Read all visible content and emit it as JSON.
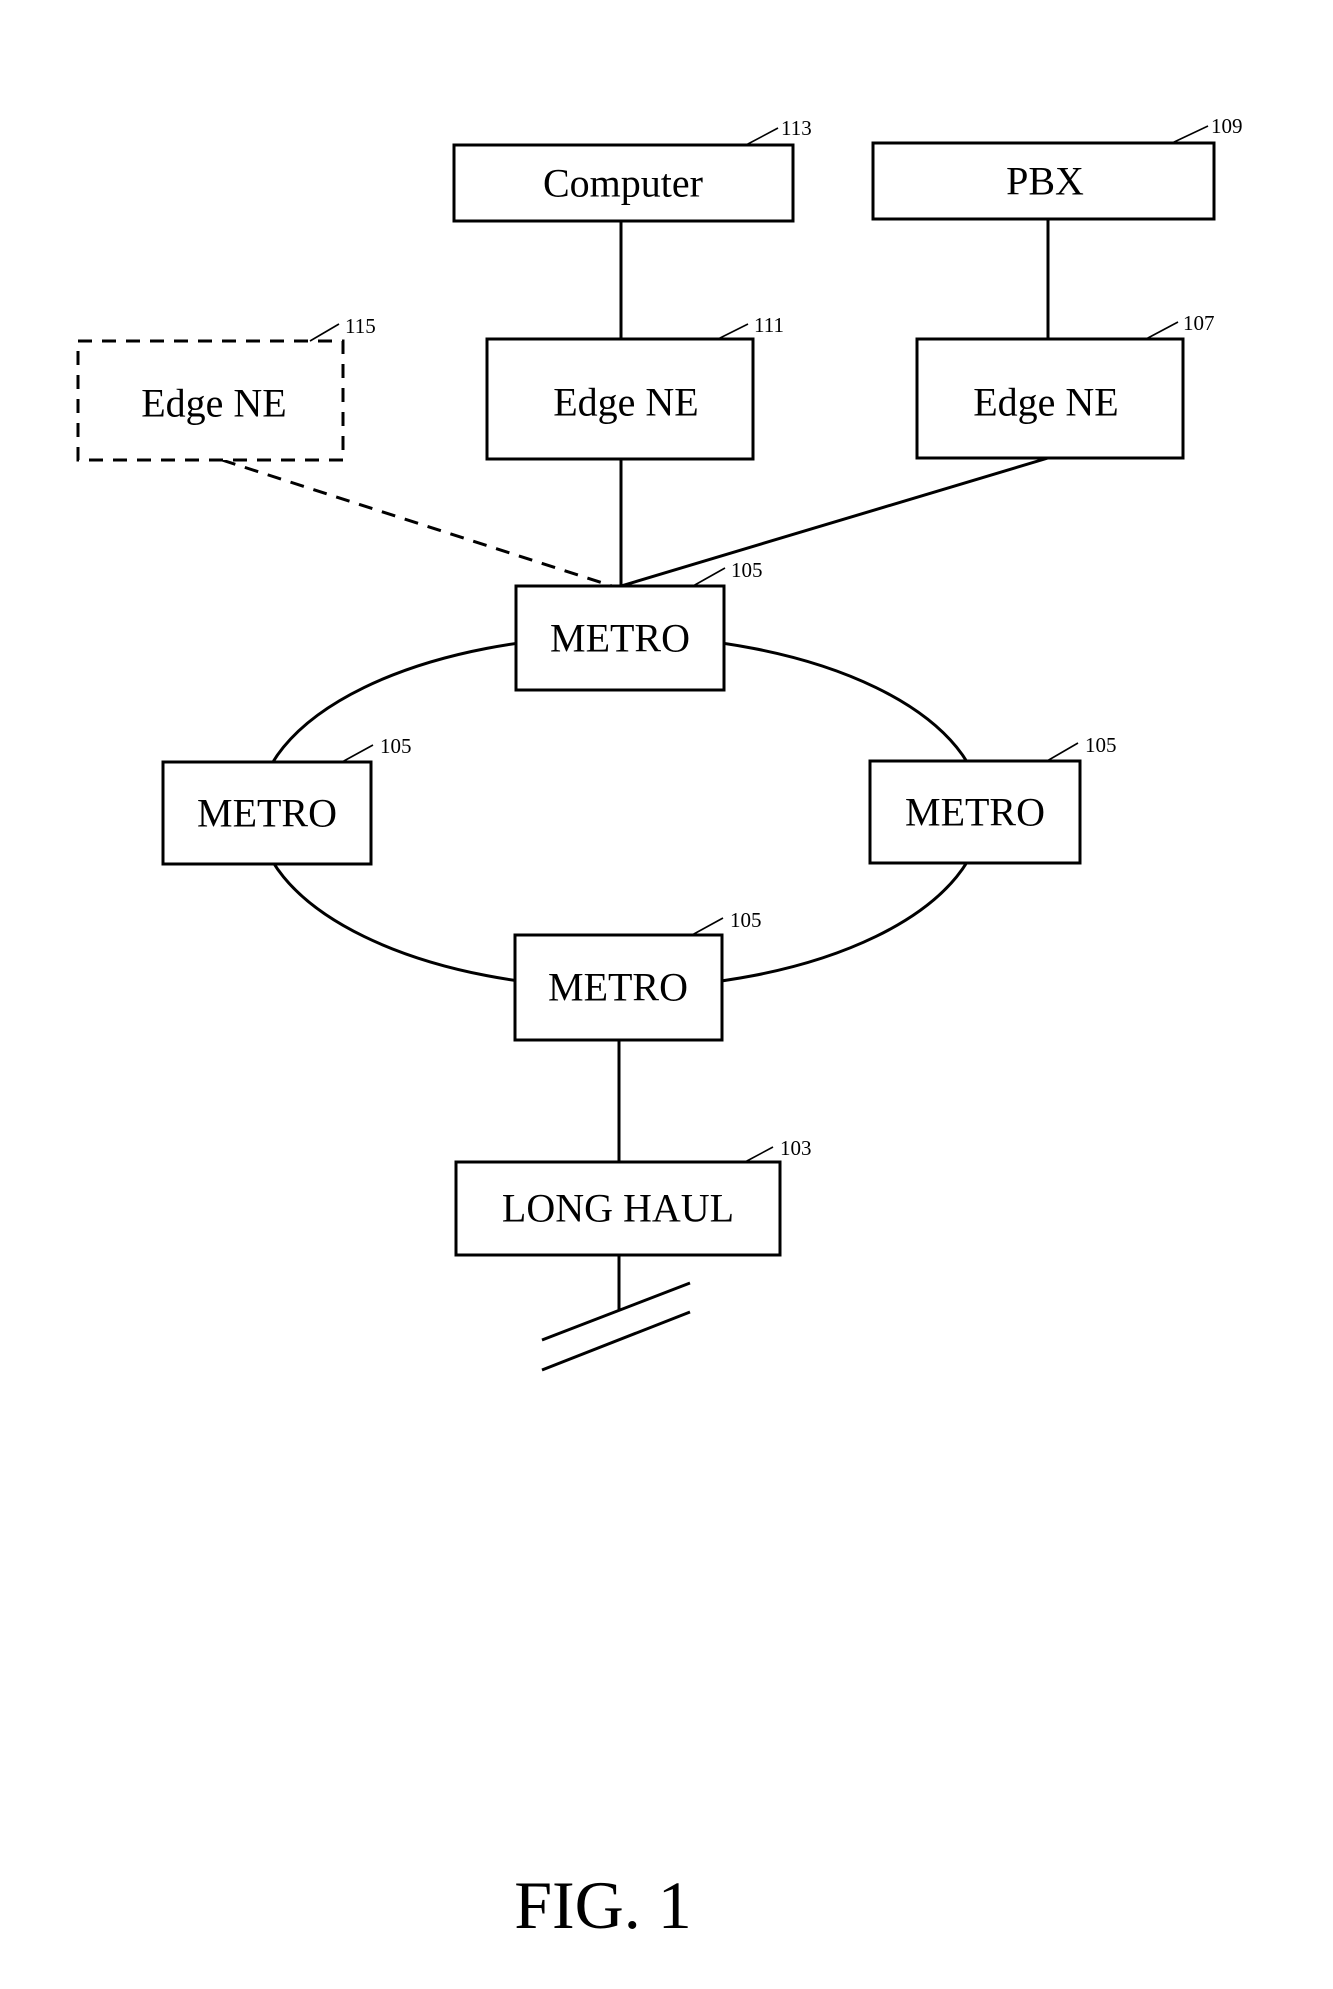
{
  "figure": {
    "caption": "FIG. 1",
    "type": "network topology diagram"
  },
  "nodes": {
    "computer": {
      "label": "Computer",
      "ref": "113"
    },
    "pbx": {
      "label": "PBX",
      "ref": "109"
    },
    "edge_ne_optional": {
      "label": "Edge NE",
      "ref": "115",
      "style": "dashed"
    },
    "edge_ne_computer": {
      "label": "Edge NE",
      "ref": "111"
    },
    "edge_ne_pbx": {
      "label": "Edge NE",
      "ref": "107"
    },
    "metro_top": {
      "label": "METRO",
      "ref": "105"
    },
    "metro_left": {
      "label": "METRO",
      "ref": "105"
    },
    "metro_right": {
      "label": "METRO",
      "ref": "105"
    },
    "metro_bottom": {
      "label": "METRO",
      "ref": "105"
    },
    "long_haul": {
      "label": "LONG HAUL",
      "ref": "103"
    }
  },
  "connections": [
    {
      "from": "computer",
      "to": "edge_ne_computer",
      "style": "solid"
    },
    {
      "from": "pbx",
      "to": "edge_ne_pbx",
      "style": "solid"
    },
    {
      "from": "edge_ne_computer",
      "to": "metro_top",
      "style": "solid"
    },
    {
      "from": "edge_ne_pbx",
      "to": "metro_top",
      "style": "solid"
    },
    {
      "from": "edge_ne_optional",
      "to": "metro_top",
      "style": "dashed"
    },
    {
      "from": "metro_top",
      "to": "metro_left",
      "style": "ring"
    },
    {
      "from": "metro_top",
      "to": "metro_right",
      "style": "ring"
    },
    {
      "from": "metro_left",
      "to": "metro_bottom",
      "style": "ring"
    },
    {
      "from": "metro_right",
      "to": "metro_bottom",
      "style": "ring"
    },
    {
      "from": "metro_bottom",
      "to": "long_haul",
      "style": "solid"
    },
    {
      "from": "long_haul",
      "to": "network-break",
      "style": "break"
    }
  ]
}
